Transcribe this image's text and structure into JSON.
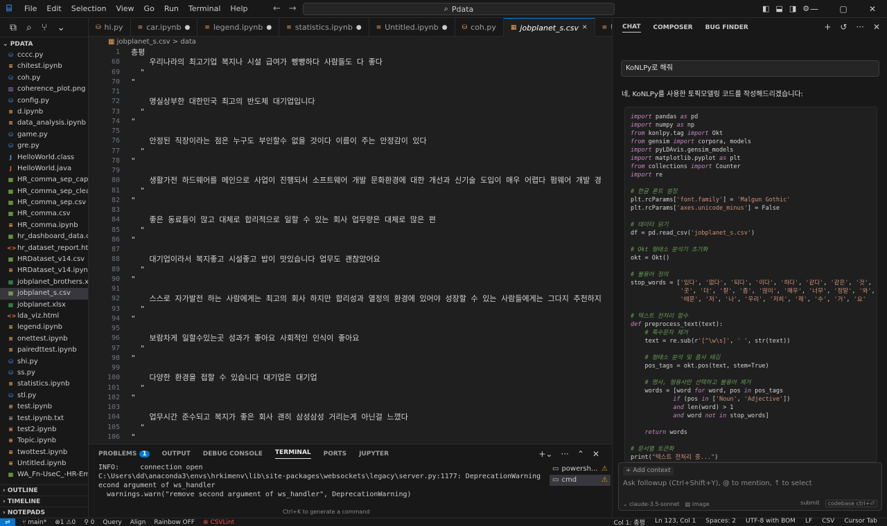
{
  "menu": [
    "File",
    "Edit",
    "Selection",
    "View",
    "Go",
    "Run",
    "Terminal",
    "Help"
  ],
  "search": {
    "icon": "search-icon",
    "text": "Pdata"
  },
  "explorer": {
    "folder": "PDATA",
    "files": [
      {
        "name": "cccc.py",
        "icon": "py"
      },
      {
        "name": "chitest.ipynb",
        "icon": "nb"
      },
      {
        "name": "coh.py",
        "icon": "py"
      },
      {
        "name": "coherence_plot.png",
        "icon": "img"
      },
      {
        "name": "config.py",
        "icon": "py"
      },
      {
        "name": "d.ipynb",
        "icon": "nb"
      },
      {
        "name": "data_analysis.ipynb",
        "icon": "nb"
      },
      {
        "name": "game.py",
        "icon": "py"
      },
      {
        "name": "gre.py",
        "icon": "py"
      },
      {
        "name": "HelloWorld.class",
        "icon": "class"
      },
      {
        "name": "HelloWorld.java",
        "icon": "java"
      },
      {
        "name": "HR_comma_sep_capp...",
        "icon": "csv"
      },
      {
        "name": "HR_comma_sep_clean...",
        "icon": "csv"
      },
      {
        "name": "HR_comma_sep.csv",
        "icon": "csv"
      },
      {
        "name": "HR_comma.csv",
        "icon": "csv"
      },
      {
        "name": "HR_comma.ipynb",
        "icon": "nb"
      },
      {
        "name": "hr_dashboard_data.csv",
        "icon": "csv"
      },
      {
        "name": "hr_dataset_report.html",
        "icon": "html"
      },
      {
        "name": "HRDataset_v14.csv",
        "icon": "csv"
      },
      {
        "name": "HRDataset_v14.ipynb....",
        "icon": "nb"
      },
      {
        "name": "jobplanet_brothers.xlsx",
        "icon": "xlsx"
      },
      {
        "name": "jobplanet_s.csv",
        "icon": "csv",
        "active": true
      },
      {
        "name": "jobplanet.xlsx",
        "icon": "xlsx"
      },
      {
        "name": "lda_viz.html",
        "icon": "html"
      },
      {
        "name": "legend.ipynb",
        "icon": "nb"
      },
      {
        "name": "onettest.ipynb",
        "icon": "nb"
      },
      {
        "name": "pairedttest.ipynb",
        "icon": "nb"
      },
      {
        "name": "shi.py",
        "icon": "py"
      },
      {
        "name": "ss.py",
        "icon": "py"
      },
      {
        "name": "statistics.ipynb",
        "icon": "nb"
      },
      {
        "name": "stl.py",
        "icon": "py"
      },
      {
        "name": "test.ipynb",
        "icon": "nb"
      },
      {
        "name": "test.ipynb.txt",
        "icon": "txt"
      },
      {
        "name": "test2.ipynb",
        "icon": "nb"
      },
      {
        "name": "Topic.ipynb",
        "icon": "nb"
      },
      {
        "name": "twottest.ipynb",
        "icon": "nb"
      },
      {
        "name": "Untitled.ipynb",
        "icon": "nb"
      },
      {
        "name": "WA_Fn-UseC_-HR-Em...",
        "icon": "csv"
      }
    ],
    "sections": [
      "OUTLINE",
      "TIMELINE",
      "NOTEPADS"
    ]
  },
  "tabs": [
    {
      "label": "hi.py",
      "dot": false,
      "active": false
    },
    {
      "label": "car.ipynb",
      "dot": true,
      "active": false
    },
    {
      "label": "legend.ipynb",
      "dot": true,
      "active": false
    },
    {
      "label": "statistics.ipynb",
      "dot": true,
      "active": false
    },
    {
      "label": "Untitled.ipynb",
      "dot": true,
      "active": false
    },
    {
      "label": "coh.py",
      "dot": false,
      "active": false
    },
    {
      "label": "jobplanet_s.csv",
      "dot": false,
      "active": true
    },
    {
      "label": "Untit",
      "dot": false,
      "active": false
    }
  ],
  "breadcrumb": {
    "file": "jobplanet_s.csv",
    "sep": ">",
    "item": "data"
  },
  "editor_lines": [
    {
      "n": "1",
      "t": "총평"
    },
    {
      "n": "68",
      "t": "    우리나라의 최고기업 복지나 시설 급여가 빵빵하다 사람들도 다 좋다"
    },
    {
      "n": "69",
      "t": "  \""
    },
    {
      "n": "70",
      "t": "\""
    },
    {
      "n": "71",
      "t": ""
    },
    {
      "n": "72",
      "t": "    명실상부한 대한민국 최고의 반도체 대기업입니다"
    },
    {
      "n": "73",
      "t": "  \""
    },
    {
      "n": "74",
      "t": "\""
    },
    {
      "n": "75",
      "t": ""
    },
    {
      "n": "76",
      "t": "    안정된 직장이라는 점은 누구도 부인할수 없을 것이다 이름이 주는 안정감이 있다"
    },
    {
      "n": "77",
      "t": "  \""
    },
    {
      "n": "78",
      "t": "\""
    },
    {
      "n": "79",
      "t": ""
    },
    {
      "n": "80",
      "t": "    생활가전 하드웨어를 메인으로 사업이 진행되서 소프트웨어 개발 문화환경에 대한 개선과 신기술 도입이 매우 어렵다 펌웨어 개발 경"
    },
    {
      "n": "81",
      "t": "  \""
    },
    {
      "n": "82",
      "t": "\""
    },
    {
      "n": "83",
      "t": ""
    },
    {
      "n": "84",
      "t": "    좋은 동료들이 많고 대체로 합리적으로 일할 수 있는 회사 업무량은 대체로 많은 편"
    },
    {
      "n": "85",
      "t": "  \""
    },
    {
      "n": "86",
      "t": "\""
    },
    {
      "n": "87",
      "t": ""
    },
    {
      "n": "88",
      "t": "    대기업이라서 복지좋고 시설좋고 밥이 맛있습니다 업무도 괜찮았어요"
    },
    {
      "n": "89",
      "t": "  \""
    },
    {
      "n": "90",
      "t": "\""
    },
    {
      "n": "91",
      "t": ""
    },
    {
      "n": "92",
      "t": "    스스로 자가발전 하는 사람에게는 최고의 회사 하지만 합리성과 열정의 환경에 있어야 성장할 수 있는 사람들에게는 그다지 추천하지"
    },
    {
      "n": "93",
      "t": "  \""
    },
    {
      "n": "94",
      "t": "\""
    },
    {
      "n": "95",
      "t": ""
    },
    {
      "n": "96",
      "t": "    보람차게 일할수있는곳 성과가 좋아요 사회적인 인식이 좋아요"
    },
    {
      "n": "97",
      "t": "  \""
    },
    {
      "n": "98",
      "t": "\""
    },
    {
      "n": "99",
      "t": ""
    },
    {
      "n": "100",
      "t": "    다양한 환경을 접할 수 있습니다 대기업은 대기업"
    },
    {
      "n": "101",
      "t": "  \""
    },
    {
      "n": "102",
      "t": "\""
    },
    {
      "n": "103",
      "t": ""
    },
    {
      "n": "104",
      "t": "    업무시간 준수되고 복지가 좋은 회사 괜히 삼성삼성 거리는게 아닌걸 느꼈다"
    },
    {
      "n": "105",
      "t": "  \""
    },
    {
      "n": "106",
      "t": "\""
    }
  ],
  "panel": {
    "tabs": [
      "PROBLEMS",
      "OUTPUT",
      "DEBUG CONSOLE",
      "TERMINAL",
      "PORTS",
      "JUPYTER"
    ],
    "problems_count": "1",
    "terminal_lines": [
      "INFO:     connection open",
      "C:\\Users\\dd\\anaconda3\\envs\\hrkimenv\\lib\\site-packages\\websockets\\legacy\\server.py:1177: DeprecationWarning: remove s",
      "econd argument of ws_handler",
      "  warnings.warn(\"remove second argument of ws_handler\", DeprecationWarning)"
    ],
    "hint": "Ctrl+K to generate a command",
    "terminals": [
      {
        "name": "powersh...",
        "warn": true,
        "selected": false
      },
      {
        "name": "cmd",
        "warn": true,
        "selected": true
      }
    ]
  },
  "chat": {
    "tabs": [
      "CHAT",
      "COMPOSER",
      "BUG FINDER"
    ],
    "user_message": "KoNLPy로 해줘",
    "reply": "네, KoNLPy를 사용한 토픽모델링 코드를 작성해드리겠습니다:",
    "code_lines": [
      "import pandas as pd",
      "import numpy as np",
      "from konlpy.tag import Okt",
      "from gensim import corpora, models",
      "import pyLDAvis.gensim_models",
      "import matplotlib.pyplot as plt",
      "from collections import Counter",
      "import re",
      "",
      "# 한글 폰트 설정",
      "plt.rcParams['font.family'] = 'Malgun Gothic'",
      "plt.rcParams['axes.unicode_minus'] = False",
      "",
      "# 데이터 읽기",
      "df = pd.read_csv('jobplanet_s.csv')",
      "",
      "# Okt 형태소 분석기 초기화",
      "okt = Okt()",
      "",
      "# 불용어 정의",
      "stop_words = ['있다', '없다', '되다', '이다', '하다', '같다', '같은', '것',",
      "              '곳', '더', '잘', '좀', '많이', '매우', '너무', '정말', '와',",
      "              '때문', '저', '나', '우리', '저희', '제', '수', '거', '요'",
      "",
      "# 텍스트 전처리 함수",
      "def preprocess_text(text):",
      "    # 특수문자 제거",
      "    text = re.sub(r'[^\\w\\s]', ' ', str(text))",
      "",
      "    # 형태소 분석 및 품사 태깅",
      "    pos_tags = okt.pos(text, stem=True)",
      "",
      "    # 명사, 형용사만 선택하고 불용어 제거",
      "    words = [word for word, pos in pos_tags",
      "            if (pos in ['Noun', 'Adjective'])",
      "            and len(word) > 1",
      "            and word not in stop_words]",
      "",
      "    return words",
      "",
      "# 문서별 토큰화",
      "print(\"텍스트 전처리 중...\")"
    ],
    "add_context": "+ Add context",
    "followup_placeholder": "Ask followup (Ctrl+Shift+Y), @ to mention, ↑ to select",
    "model": "claude-3.5-sonnet",
    "image_label": "image",
    "submit": "submit",
    "codebase": "codebase ctrl+⏎"
  },
  "status": {
    "branch": "main*",
    "errors": "⊗1 ⚠0",
    "info": "0",
    "left_items": [
      "Query",
      "Align",
      "Rainbow OFF"
    ],
    "csvlint": "CSVLint",
    "right_items": [
      "Col 1: 총평",
      "Ln 123, Col 1",
      "Spaces: 2",
      "UTF-8 with BOM",
      "LF",
      "CSV",
      "Cursor Tab"
    ]
  }
}
